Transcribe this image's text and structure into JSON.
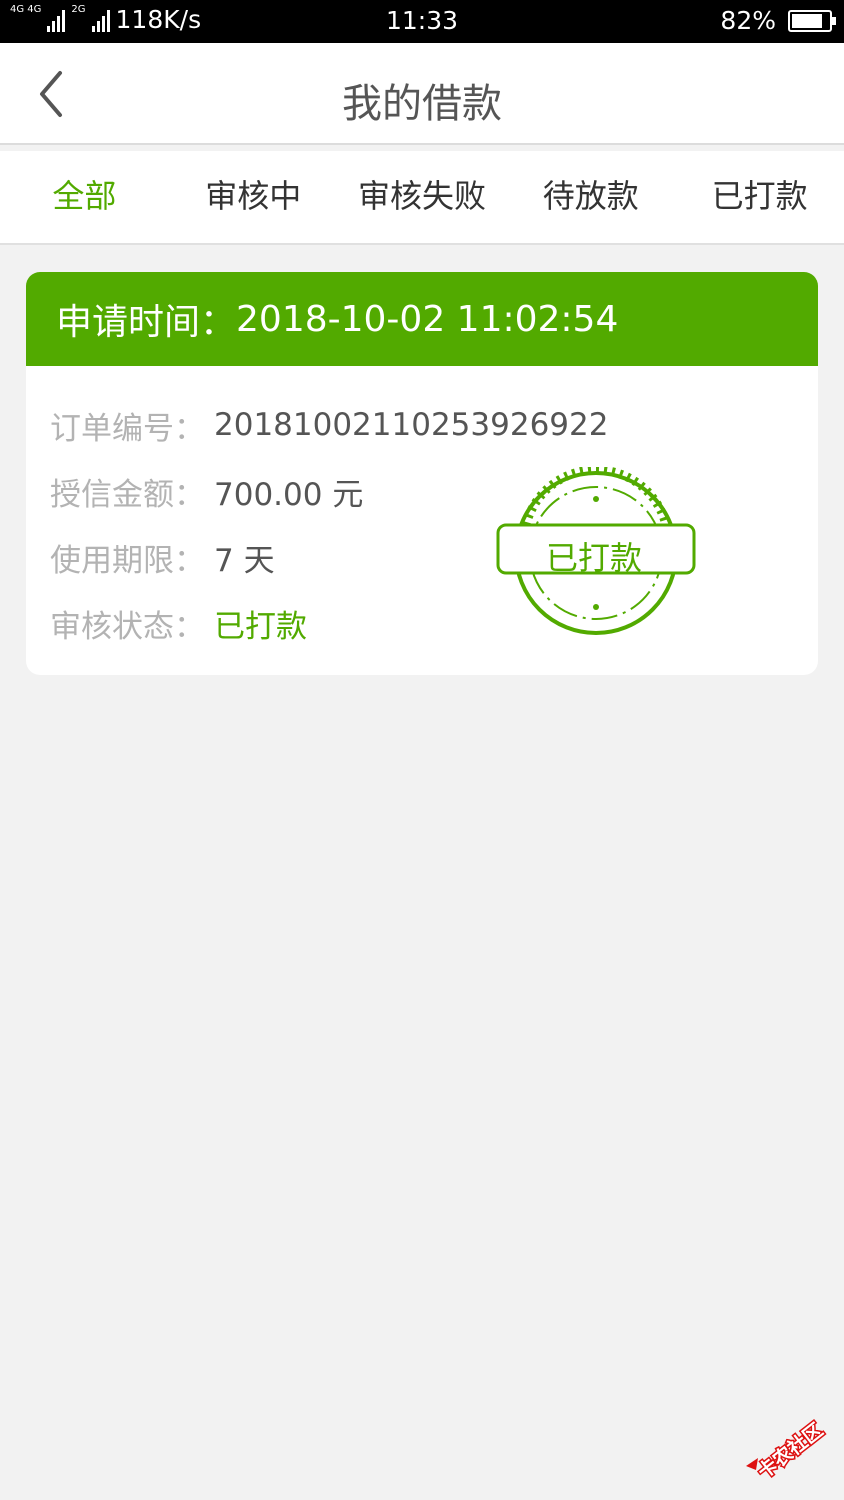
{
  "status_bar": {
    "net_type": "4G 4G",
    "net_type_2": "2G",
    "speed": "118K/s",
    "time": "11:33",
    "battery": "82%",
    "battery_level": 0.82
  },
  "nav": {
    "title": "我的借款",
    "back_icon": "chevron-left-icon"
  },
  "tabs": [
    {
      "label": "全部",
      "active": true
    },
    {
      "label": "审核中",
      "active": false
    },
    {
      "label": "审核失败",
      "active": false
    },
    {
      "label": "待放款",
      "active": false
    },
    {
      "label": "已打款",
      "active": false
    }
  ],
  "loan": {
    "applied_label": "申请时间：",
    "applied_time": "2018-10-02 11:02:54",
    "order_no_label": "订单编号：",
    "order_no": "20181002110253926922",
    "credit_label": "授信金额：",
    "credit_amount": "700.00 元",
    "term_label": "使用期限：",
    "term": "7 天",
    "status_label": "审核状态：",
    "status": "已打款",
    "stamp_text": "已打款"
  },
  "watermark": {
    "text": "卡农社区"
  },
  "colors": {
    "accent": "#52aa00",
    "label_gray": "#b3b3b3",
    "value_gray": "#555555",
    "background": "#f2f2f2"
  }
}
